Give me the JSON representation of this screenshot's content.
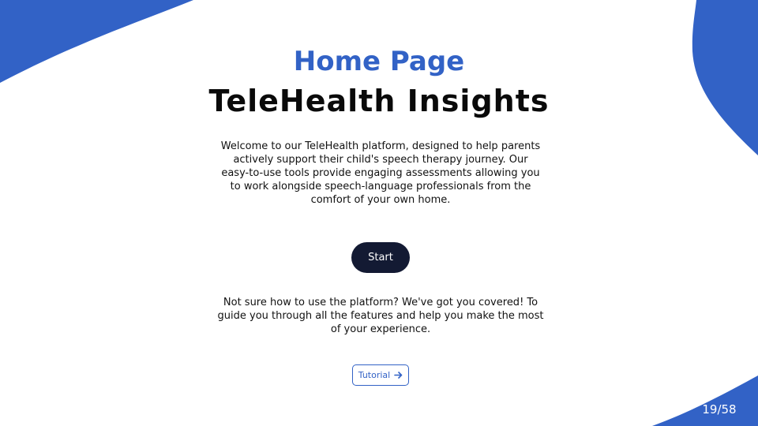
{
  "header": {
    "page_heading": "Home Page",
    "app_title": "TeleHealth Insights"
  },
  "main": {
    "intro_text": "Welcome to our TeleHealth platform, designed to help parents actively support their child's speech therapy journey. Our easy-to-use tools provide engaging assessments allowing you to work alongside speech-language professionals from the comfort of your own home.",
    "start_label": "Start",
    "help_text": "Not sure how to use the platform? We've got you covered! To guide you through all the features and help you make the most of your experience.",
    "tutorial_label": "Tutorial",
    "tutorial_icon": "arrow-right-icon"
  },
  "footer": {
    "page_counter": "19/58"
  },
  "colors": {
    "accent": "#3262c6",
    "start_button_bg": "#131a33",
    "background": "#ffffff"
  }
}
